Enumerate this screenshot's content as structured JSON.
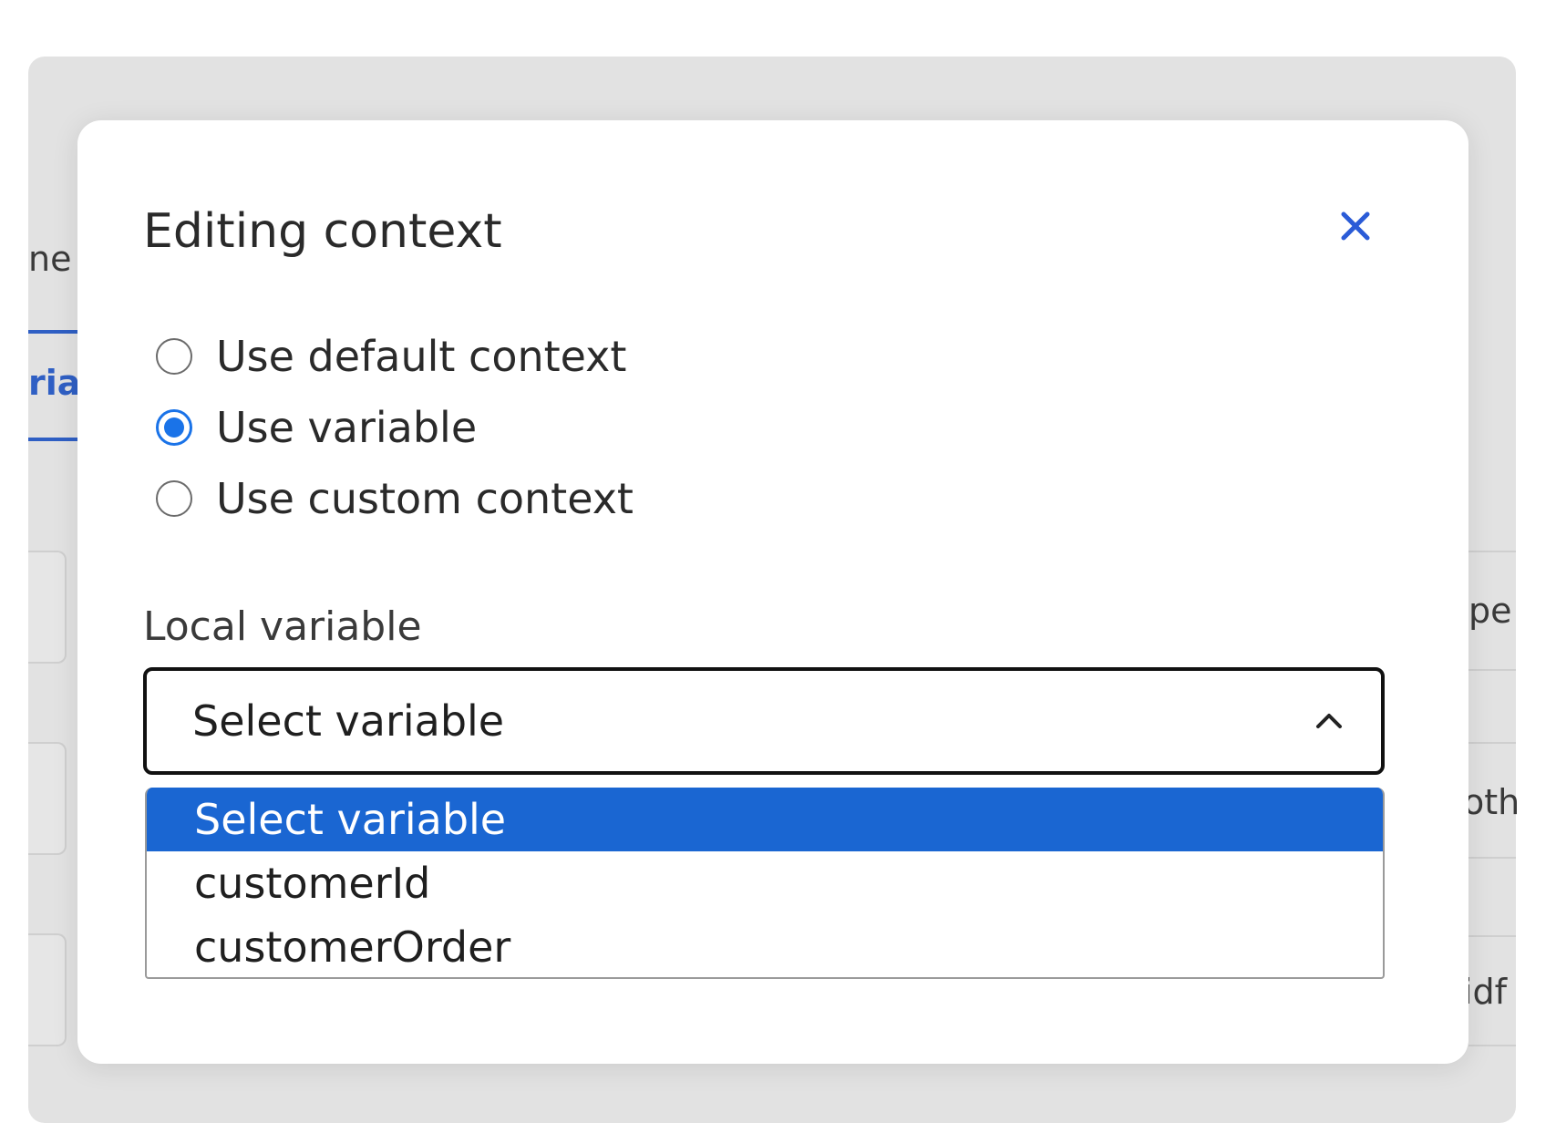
{
  "background": {
    "fragments": [
      "ne",
      "ria",
      "pe",
      "oth",
      "idf"
    ]
  },
  "dialog": {
    "title": "Editing context",
    "close_icon": "close-icon",
    "radio_options": [
      {
        "label": "Use default context",
        "checked": false
      },
      {
        "label": "Use variable",
        "checked": true
      },
      {
        "label": "Use custom context",
        "checked": false
      }
    ],
    "field_label": "Local variable",
    "select": {
      "value": "Select variable",
      "expanded": true,
      "options": [
        {
          "label": "Select variable",
          "selected": true
        },
        {
          "label": "customerId",
          "selected": false
        },
        {
          "label": "customerOrder",
          "selected": false
        }
      ]
    }
  },
  "colors": {
    "accent": "#1a73e8",
    "highlight": "#1a66d2",
    "close_icon": "#2a5bd7"
  }
}
